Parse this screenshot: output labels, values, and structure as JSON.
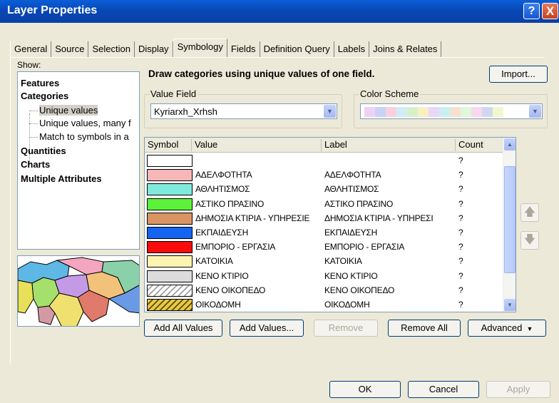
{
  "window": {
    "title": "Layer Properties",
    "help_label": "?",
    "close_label": "X"
  },
  "tabs": [
    {
      "label": "General"
    },
    {
      "label": "Source"
    },
    {
      "label": "Selection"
    },
    {
      "label": "Display"
    },
    {
      "label": "Symbology",
      "active": true
    },
    {
      "label": "Fields"
    },
    {
      "label": "Definition Query"
    },
    {
      "label": "Labels"
    },
    {
      "label": "Joins & Relates"
    }
  ],
  "show": {
    "label": "Show:",
    "items": [
      {
        "label": "Features"
      },
      {
        "label": "Categories"
      },
      {
        "label": "Unique values"
      },
      {
        "label": "Unique values, many f"
      },
      {
        "label": "Match to symbols in a"
      },
      {
        "label": "Quantities"
      },
      {
        "label": "Charts"
      },
      {
        "label": "Multiple Attributes"
      }
    ]
  },
  "symbology": {
    "headline": "Draw categories using unique values of one field.",
    "import_label": "Import...",
    "value_field": {
      "label": "Value Field",
      "value": "Kyriarxh_Xrhsh"
    },
    "color_scheme": {
      "label": "Color Scheme",
      "colors": [
        "#f0d0f5",
        "#c8d2f8",
        "#f8d0e0",
        "#d0ecf8",
        "#d8f0c8",
        "#f8f0c0",
        "#e8d8f8",
        "#c8f0f0",
        "#f8e0d0",
        "#e0f8d8",
        "#f8d8f0",
        "#d0d8f0",
        "#f0f8d0"
      ]
    }
  },
  "table": {
    "headers": [
      "Symbol",
      "Value",
      "Label",
      "Count"
    ],
    "rows": [
      {
        "color": "#ffffff",
        "value": "",
        "label": "",
        "count": "?"
      },
      {
        "color": "#f7b6b8",
        "value": "ΑΔΕΛΦΟΤΗΤΑ",
        "label": "ΑΔΕΛΦΟΤΗΤΑ",
        "count": "?"
      },
      {
        "color": "#7fe9dc",
        "value": "ΑΘΛΗΤΙΣΜΟΣ",
        "label": "ΑΘΛΗΤΙΣΜΟΣ",
        "count": "?"
      },
      {
        "color": "#5cf23a",
        "value": "ΑΣΤΙΚΟ ΠΡΑΣΙΝΟ",
        "label": "ΑΣΤΙΚΟ ΠΡΑΣΙΝΟ",
        "count": "?"
      },
      {
        "color": "#d99464",
        "value": "ΔΗΜΟΣΙΑ ΚΤΙΡΙΑ - ΥΠΗΡΕΣΙΕ",
        "label": "ΔΗΜΟΣΙΑ ΚΤΙΡΙΑ - ΥΠΗΡΕΣΙ",
        "count": "?"
      },
      {
        "color": "#1464f0",
        "value": "ΕΚΠΑΙΔΕΥΣΗ",
        "label": "ΕΚΠΑΙΔΕΥΣΗ",
        "count": "?"
      },
      {
        "color": "#f80c0c",
        "value": "ΕΜΠΟΡΙΟ - ΕΡΓΑΣΙΑ",
        "label": "ΕΜΠΟΡΙΟ - ΕΡΓΑΣΙΑ",
        "count": "?"
      },
      {
        "color": "#fcf4b0",
        "value": "ΚΑΤΟΙΚΙΑ",
        "label": "ΚΑΤΟΙΚΙΑ",
        "count": "?"
      },
      {
        "color": "#dcdcdc",
        "value": "ΚΕΝΟ ΚΤΙΡΙΟ",
        "label": "ΚΕΝΟ ΚΤΙΡΙΟ",
        "count": "?"
      },
      {
        "color": "hatch-gray",
        "value": "ΚΕΝΟ ΟΙΚΟΠΕΔΟ",
        "label": "ΚΕΝΟ ΟΙΚΟΠΕΔΟ",
        "count": "?"
      },
      {
        "color": "hatch-yellow",
        "value": "ΟΙΚΟΔΟΜΗ",
        "label": "ΟΙΚΟΔΟΜΗ",
        "count": "?"
      }
    ]
  },
  "actions": {
    "add_all": "Add All Values",
    "add_values": "Add Values...",
    "remove": "Remove",
    "remove_all": "Remove All",
    "advanced": "Advanced"
  },
  "footer": {
    "ok": "OK",
    "cancel": "Cancel",
    "apply": "Apply"
  }
}
